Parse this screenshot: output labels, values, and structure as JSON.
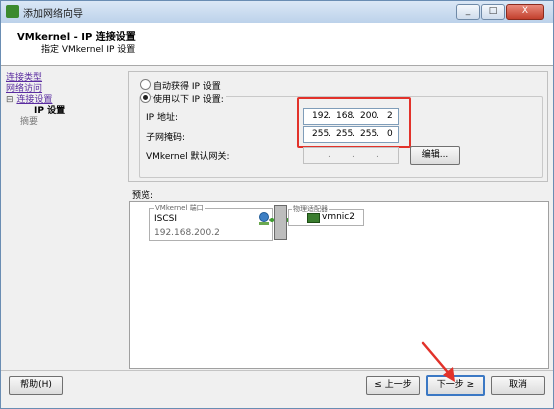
{
  "window": {
    "title": "添加网络向导",
    "minimize_label": "_",
    "maximize_label": "□",
    "close_label": "X"
  },
  "header": {
    "title": "VMkernel - IP 连接设置",
    "subtitle": "指定 VMkernel IP 设置"
  },
  "nav": {
    "items": [
      {
        "label": "连接类型",
        "state": "link"
      },
      {
        "label": "网络访问",
        "state": "link"
      },
      {
        "label": "连接设置",
        "state": "link"
      },
      {
        "label": "IP 设置",
        "state": "current"
      },
      {
        "label": "摘要",
        "state": "disabled"
      }
    ],
    "collapse_glyph": "⊟"
  },
  "form": {
    "auto_ip_label": "自动获得 IP 设置",
    "manual_ip_label": "使用以下 IP 设置:",
    "ip_label": "IP 地址:",
    "mask_label": "子网掩码:",
    "gateway_label": "VMkernel 默认网关:",
    "ip_octets": [
      "192",
      "168",
      "200",
      "2"
    ],
    "mask_octets": [
      "255",
      "255",
      "255",
      "0"
    ],
    "gateway_dots": [
      ".",
      ".",
      "."
    ],
    "edit_button": "编辑..."
  },
  "preview": {
    "label": "预览:",
    "vmkernel_port_title": "VMkernel 端口",
    "vmkernel_name": "ISCSI",
    "vmkernel_ip": "192.168.200.2",
    "physical_adapters_title": "物理适配器",
    "adapter_name": "vmnic2"
  },
  "footer": {
    "help_button": "帮助(H)",
    "back_button": "≤ 上一步",
    "next_button": "下一步 ≥",
    "cancel_button": "取消"
  },
  "colors": {
    "highlight_box": "#e2322a",
    "arrow": "#e2322a",
    "nav_link": "#5a2ca0"
  }
}
